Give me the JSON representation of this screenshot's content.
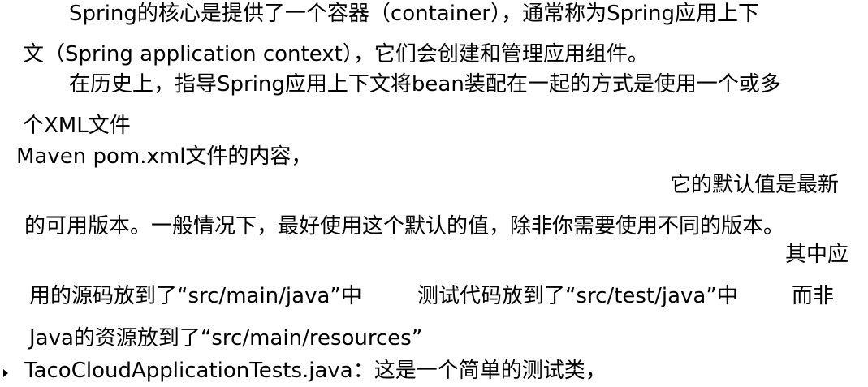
{
  "lines": {
    "l1": "Spring的核心是提供了一个容器（container），通常称为Spring应用上下",
    "l2": "文（Spring application context），它们会创建和管理应用组件。",
    "l3": "在历史上，指导Spring应用上下文将bean装配在一起的方式是使用一个或多",
    "l4": "个XML文件",
    "l5": "Maven pom.xml文件的内容，",
    "l6": "它的默认值是最新",
    "l7": "的可用版本。一般情况下，最好使用这个默认的值，除非你需要使用不同的版本。",
    "l8": "其中应",
    "l9a": "用的源码放到了“src/main/java”中",
    "l9b": "测试代码放到了“src/test/java”中",
    "l9c": "而非",
    "l10": "Java的资源放到了“src/main/resources”",
    "l11": "TacoCloudApplicationTests.java：这是一个简单的测试类，"
  }
}
